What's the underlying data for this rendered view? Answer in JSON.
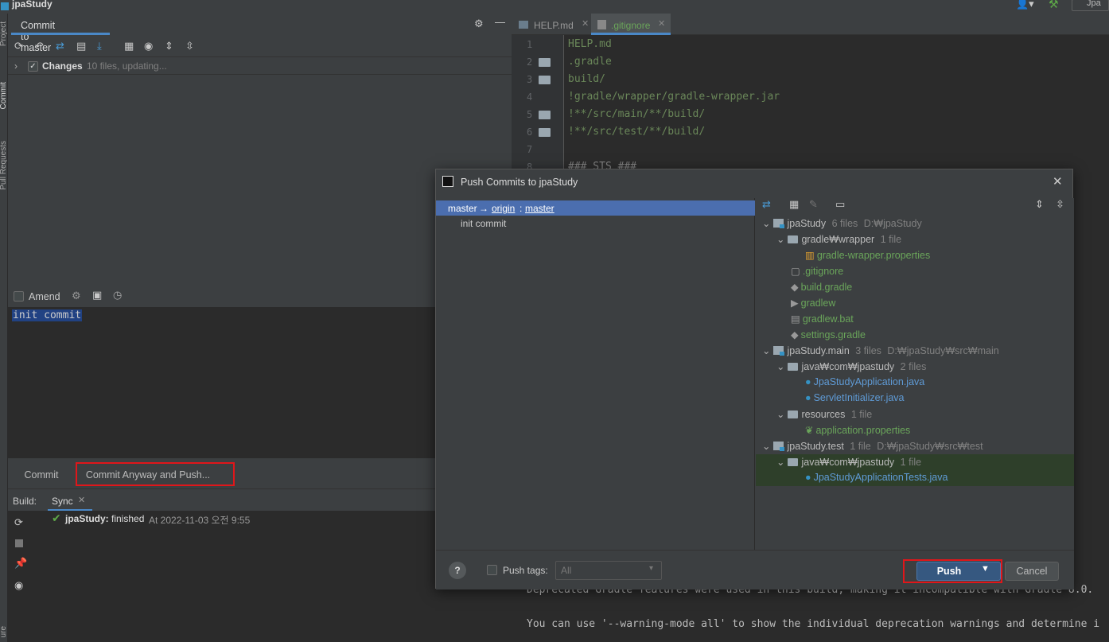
{
  "app": {
    "title": "jpaStudy",
    "right_title": "Jpa"
  },
  "side_strip": {
    "project": "Project",
    "commit": "Commit",
    "pull_requests": "Pull Requests",
    "structure": "ure"
  },
  "commit_panel": {
    "tab_label": "Commit to master",
    "changes_label": "Changes",
    "changes_count": "10 files, updating...",
    "amend_label": "Amend",
    "message": "init commit",
    "commit_button": "Commit",
    "commit_push_button": "Commit Anyway and Push..."
  },
  "build": {
    "label": "Build:",
    "tab": "Sync",
    "project": "jpaStudy:",
    "status": "finished",
    "time": "At 2022-11-03 오전 9:55"
  },
  "editor": {
    "tabs": [
      {
        "label": "HELP.md"
      },
      {
        "label": ".gitignore"
      }
    ],
    "line_numbers": [
      "1",
      "2",
      "3",
      "4",
      "5",
      "6",
      "7",
      "8"
    ],
    "lines": [
      "HELP.md",
      ".gradle",
      "build/",
      "!gradle/wrapper/gradle-wrapper.jar",
      "!**/src/main/**/build/",
      "!**/src/test/**/build/",
      "",
      "### STS ###"
    ],
    "output_1": "Deprecated Gradle features were used in this build, making it incompatible with Gradle 8.0.",
    "output_2": "You can use '--warning-mode all' to show the individual deprecation warnings and determine i"
  },
  "dialog": {
    "title": "Push Commits to jpaStudy",
    "branch": {
      "local": "master",
      "arrow": "→",
      "remote": "origin",
      "sep": ":",
      "remote_branch": "master"
    },
    "commit": "init commit",
    "tree": {
      "root1": {
        "name": "jpaStudy",
        "count": "6 files",
        "path": "D:₩jpaStudy"
      },
      "gw_folder": {
        "name": "gradle₩wrapper",
        "count": "1 file"
      },
      "gw_props": "gradle-wrapper.properties",
      "gitignore": ".gitignore",
      "build_gradle": "build.gradle",
      "gradlew": "gradlew",
      "gradlew_bat": "gradlew.bat",
      "settings_gradle": "settings.gradle",
      "root2": {
        "name": "jpaStudy.main",
        "count": "3 files",
        "path": "D:₩jpaStudy₩src₩main"
      },
      "main_java": {
        "name": "java₩com₩jpastudy",
        "count": "2 files"
      },
      "app_java": "JpaStudyApplication.java",
      "servlet_java": "ServletInitializer.java",
      "resources": {
        "name": "resources",
        "count": "1 file"
      },
      "app_props": "application.properties",
      "root3": {
        "name": "jpaStudy.test",
        "count": "1 file",
        "path": "D:₩jpaStudy₩src₩test"
      },
      "test_java": {
        "name": "java₩com₩jpastudy",
        "count": "1 file"
      },
      "tests_java": "JpaStudyApplicationTests.java"
    },
    "push_tags_label": "Push tags:",
    "push_tags_value": "All",
    "push_button": "Push",
    "cancel_button": "Cancel",
    "help": "?"
  },
  "colors": {
    "accent": "#4a88c7",
    "push_blue": "#365880",
    "selection": "#4b6eaf",
    "highlight_red": "#e0161a",
    "vcs_green": "#6aa55a"
  }
}
